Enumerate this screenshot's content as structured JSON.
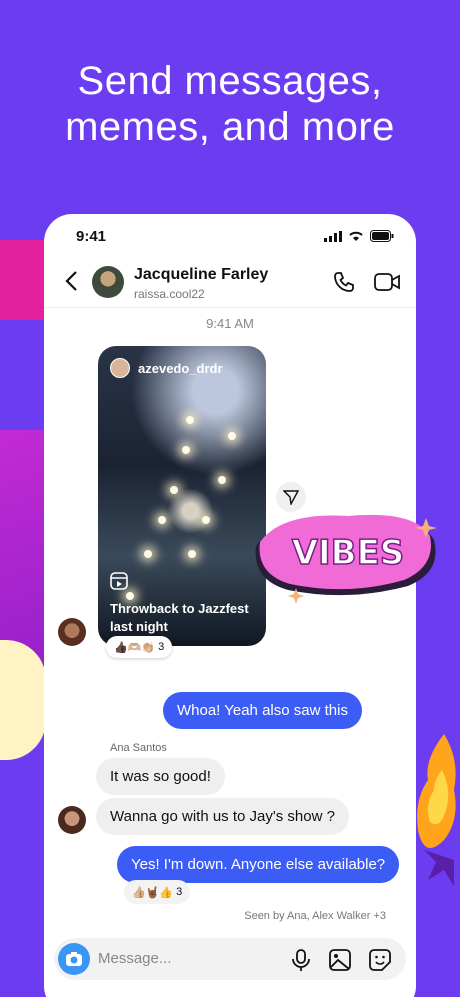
{
  "headline": "Send messages,\nmemes, and more",
  "status_bar": {
    "time": "9:41"
  },
  "header": {
    "name": "Jacqueline Farley",
    "handle": "raissa.cool22"
  },
  "timestamp": "9:41 AM",
  "reel": {
    "user": "azevedo_drdr",
    "caption": "Throwback to Jazzfest last night",
    "reactions": "👍🏿🫶🏼👏🏼",
    "reaction_count": "3"
  },
  "sticker_text": "VIBES",
  "messages": {
    "out1": "Whoa! Yeah also saw this",
    "sender": "Ana Santos",
    "in1": "It was so good!",
    "in2": "Wanna go with us to Jay's show ?",
    "out2": "Yes! I'm down. Anyone else available?",
    "reactions2": "👍🏼🤘🏾👍",
    "reaction_count2": "3",
    "seen": "Seen by Ana, Alex Walker +3"
  },
  "composer": {
    "placeholder": "Message..."
  },
  "colors": {
    "background": "#6b3cf0",
    "outgoing_bubble": "#3b5cf5",
    "incoming_bubble": "#efefef"
  }
}
